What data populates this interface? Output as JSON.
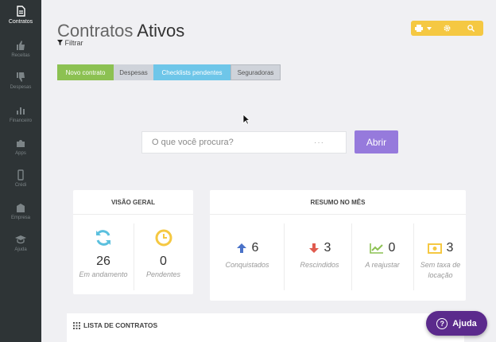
{
  "sidebar": {
    "items": [
      {
        "label": "Contratos",
        "icon": "document-icon",
        "active": true
      },
      {
        "label": "Receitas",
        "icon": "thumbs-up-icon"
      },
      {
        "label": "Despesas",
        "icon": "thumbs-down-icon"
      },
      {
        "label": "Financeiro",
        "icon": "bar-chart-icon"
      },
      {
        "label": "Apps",
        "icon": "puzzle-icon"
      },
      {
        "label": "Crédi",
        "icon": "mobile-icon"
      },
      {
        "label": "Empresa",
        "icon": "building-icon"
      },
      {
        "label": "Ajuda",
        "icon": "graduation-cap-icon"
      }
    ]
  },
  "header": {
    "title_light": "Contratos",
    "title_bold": "Ativos",
    "filter_label": "Filtrar"
  },
  "tabs": [
    "Novo contrato",
    "Despesas",
    "Checklists pendentes",
    "Seguradoras"
  ],
  "search": {
    "placeholder": "O que você procura?",
    "dots": "···",
    "button_label": "Abrir"
  },
  "visao_geral": {
    "title": "VISÃO GERAL",
    "items": [
      {
        "value": "26",
        "caption": "Em andamento",
        "icon": "refresh-icon",
        "color": "#5bc0de"
      },
      {
        "value": "0",
        "caption": "Pendentes",
        "icon": "clock-icon",
        "color": "#f5c842"
      }
    ]
  },
  "resumo_mes": {
    "title": "RESUMO NO MÊS",
    "items": [
      {
        "value": "6",
        "caption": "Conquistados",
        "icon": "arrow-up-icon",
        "color": "#4a72c8"
      },
      {
        "value": "3",
        "caption": "Rescindidos",
        "icon": "arrow-down-icon",
        "color": "#e05a4e"
      },
      {
        "value": "0",
        "caption": "A reajustar",
        "icon": "line-chart-icon",
        "color": "#8cc152"
      },
      {
        "value": "3",
        "caption": "Sem taxa de locação",
        "icon": "money-icon",
        "color": "#f5c842"
      }
    ]
  },
  "lista": {
    "title": "LISTA DE CONTRATOS"
  },
  "help": {
    "label": "Ajuda"
  },
  "colors": {
    "sidebar": "#2e3436",
    "accent_purple": "#967adc",
    "help_purple": "#5b2a8c"
  }
}
